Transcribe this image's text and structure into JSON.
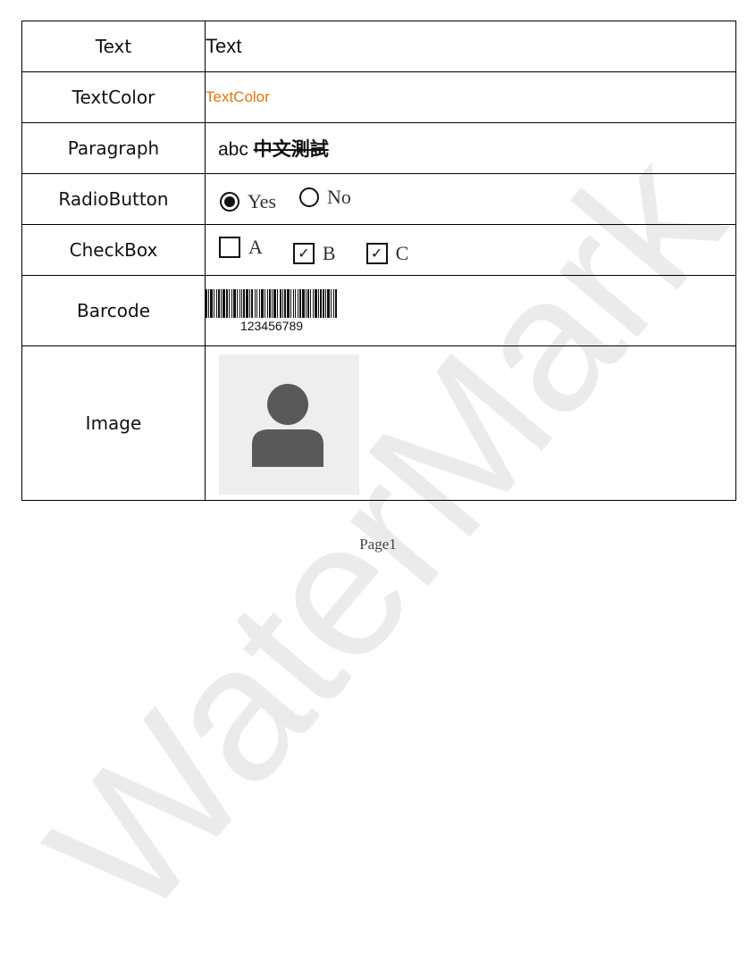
{
  "watermark": "WaterMark",
  "rows": {
    "text": {
      "label": "Text",
      "value": "Text"
    },
    "textcolor": {
      "label": "TextColor",
      "value": "TextColor",
      "color": "#e8720c"
    },
    "paragraph": {
      "label": "Paragraph",
      "latin": "abc",
      "cjk": "中文測試"
    },
    "radio": {
      "label": "RadioButton",
      "options": [
        {
          "label": "Yes",
          "selected": true
        },
        {
          "label": "No",
          "selected": false
        }
      ]
    },
    "checkbox": {
      "label": "CheckBox",
      "options": [
        {
          "label": "A",
          "checked": false
        },
        {
          "label": "B",
          "checked": true
        },
        {
          "label": "C",
          "checked": true
        }
      ]
    },
    "barcode": {
      "label": "Barcode",
      "value": "123456789"
    },
    "image": {
      "label": "Image",
      "icon": "user-avatar-icon"
    }
  },
  "footer": {
    "page": "Page1"
  }
}
